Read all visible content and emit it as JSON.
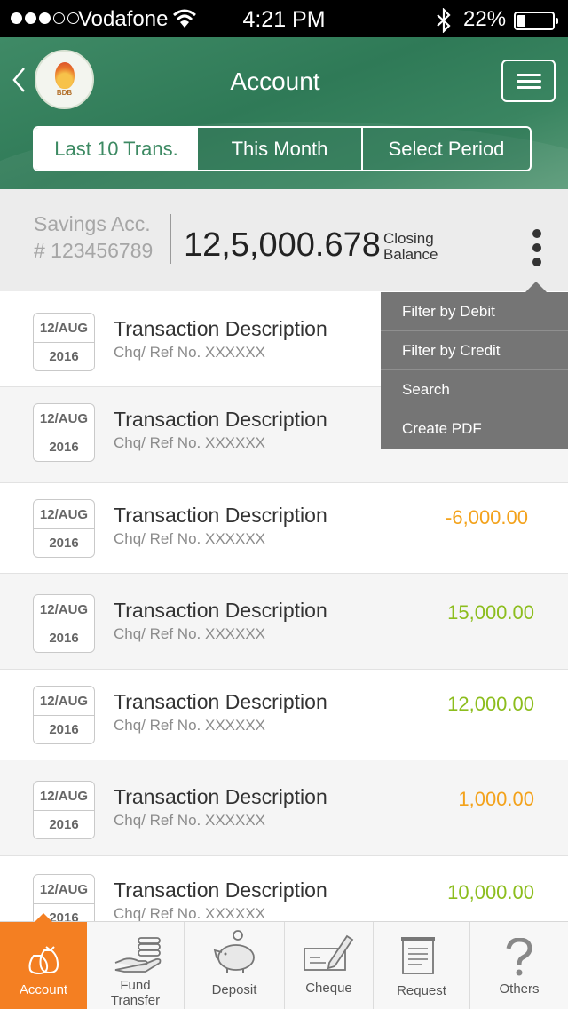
{
  "status_bar": {
    "carrier": "Vodafone",
    "time": "4:21 PM",
    "battery": "22%",
    "battery_level": 0.22,
    "signal_bars": 3,
    "signal_total": 5
  },
  "header": {
    "title": "Account",
    "logo_text": "BDB"
  },
  "tabs": [
    {
      "label": "Last 10 Trans.",
      "active": true
    },
    {
      "label": "This Month",
      "active": false
    },
    {
      "label": "Select Period",
      "active": false
    }
  ],
  "account": {
    "type": "Savings Acc.",
    "number": "# 123456789",
    "balance": "12,5,000.678",
    "closing_label_1": "Closing",
    "closing_label_2": "Balance"
  },
  "dropdown": {
    "items": [
      "Filter by Debit",
      "Filter by Credit",
      "Search",
      "Create PDF"
    ]
  },
  "transactions": [
    {
      "date": "12/AUG",
      "year": "2016",
      "description": "Transaction Description",
      "ref": "Chq/ Ref No. XXXXXX",
      "amount": ""
    },
    {
      "date": "12/AUG",
      "year": "2016",
      "description": "Transaction Description",
      "ref": "Chq/ Ref No. XXXXXX",
      "amount": ""
    },
    {
      "date": "12/AUG",
      "year": "2016",
      "description": "Transaction Description",
      "ref": "Chq/ Ref No. XXXXXX",
      "amount": "-6,000.00"
    },
    {
      "date": "12/AUG",
      "year": "2016",
      "description": "Transaction Description",
      "ref": "Chq/ Ref No. XXXXXX",
      "amount": "15,000.00"
    },
    {
      "date": "12/AUG",
      "year": "2016",
      "description": "Transaction Description",
      "ref": "Chq/ Ref No. XXXXXX",
      "amount": "12,000.00"
    },
    {
      "date": "12/AUG",
      "year": "2016",
      "description": "Transaction Description",
      "ref": "Chq/ Ref No. XXXXXX",
      "amount": "1,000.00"
    },
    {
      "date": "12/AUG",
      "year": "2016",
      "description": "Transaction Description",
      "ref": "Chq/ Ref No. XXXXXX",
      "amount": "10,000.00"
    }
  ],
  "bottom_nav": [
    {
      "label": "Account",
      "icon": "money-bags-icon",
      "active": true
    },
    {
      "label_1": "Fund",
      "label_2": "Transfer",
      "icon": "hand-coins-icon",
      "active": false
    },
    {
      "label": "Deposit",
      "icon": "piggy-bank-icon",
      "active": false
    },
    {
      "label": "Cheque",
      "icon": "cheque-pen-icon",
      "active": false
    },
    {
      "label": "Request",
      "icon": "document-icon",
      "active": false
    },
    {
      "label": "Others",
      "icon": "question-mark-icon",
      "active": false
    }
  ],
  "colors": {
    "header_green": "#3d8a63",
    "accent_orange": "#f47f22",
    "credit_green": "#8cbd1d",
    "debit_orange": "#f3a21b"
  }
}
